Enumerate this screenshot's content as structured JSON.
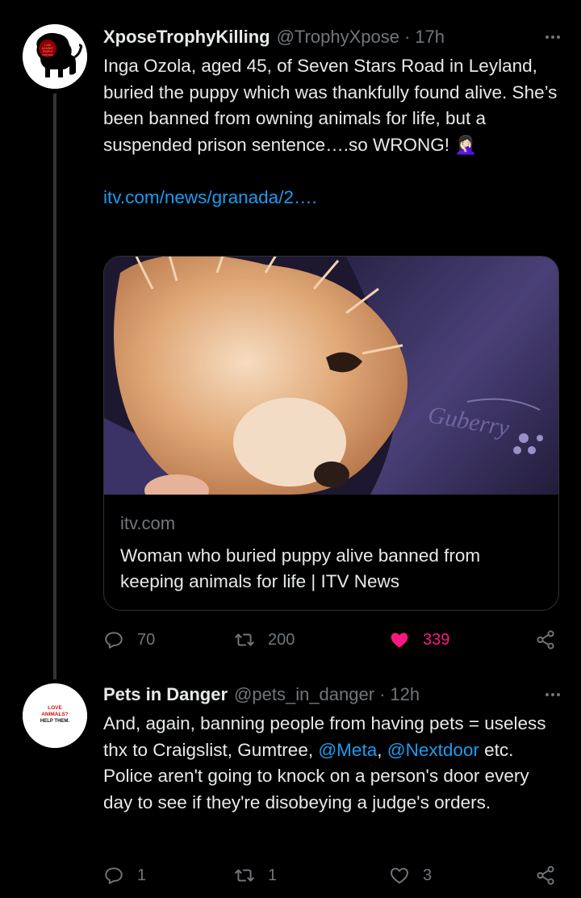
{
  "tweets": [
    {
      "author": {
        "name": "XposeTrophyKilling",
        "handle": "@TrophyXpose",
        "avatar_text": "I AM AGAINST TROPHY HUNTING!"
      },
      "separator": "·",
      "time": "17h",
      "text": "Inga Ozola, aged 45, of Seven Stars Road in Leyland, buried the puppy which was thankfully found alive. She’s been banned from owning animals for life, but a suspended prison sentence….so WRONG! 🤦🏻‍♀️",
      "link": "itv.com/news/granada/2….",
      "card": {
        "domain": "itv.com",
        "title": "Woman who buried puppy alive banned from keeping animals for life | ITV News",
        "image_description": "wet fluffy puppy on purple fabric"
      },
      "stats": {
        "replies": "70",
        "retweets": "200",
        "likes": "339",
        "liked": true
      }
    },
    {
      "author": {
        "name": "Pets in Danger",
        "handle": "@pets_in_danger",
        "avatar_text": [
          "LOVE",
          "ANIMALS?",
          "HELP THEM."
        ]
      },
      "separator": "·",
      "time": "12h",
      "text_parts": [
        "And, again, banning people from having pets = useless thx to Craigslist, Gumtree, ",
        "@Meta",
        ", ",
        "@Nextdoor",
        " etc. Police aren't going to knock on a person's door every day to see if they're disobeying a judge's orders."
      ],
      "stats": {
        "replies": "1",
        "retweets": "1",
        "likes": "3",
        "liked": false
      }
    }
  ],
  "icons": [
    "more-icon",
    "reply-icon",
    "retweet-icon",
    "like-icon",
    "share-icon"
  ],
  "colors": {
    "background": "#000000",
    "text": "#e7e9ea",
    "secondary": "#71767b",
    "link": "#1d9bf0",
    "like": "#f91880",
    "border": "#2f3336"
  }
}
